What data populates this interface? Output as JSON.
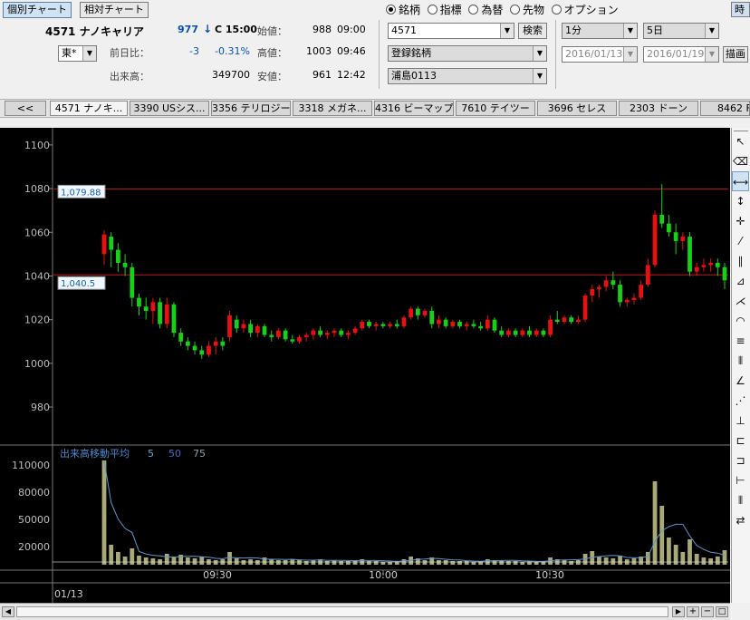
{
  "header": {
    "tab_individual": "個別チャート",
    "tab_relative": "相対チャート",
    "stock_name": "4571 ナノキャリア",
    "exchange": "東*",
    "price": "977",
    "price_arrow": "↓",
    "price_time": "C 15:00",
    "prev_label": "前日比：",
    "change": "-3",
    "change_pct": "-0.31%",
    "volume_label": "出来高：",
    "volume": "349700",
    "open_label": "始値：",
    "open_val": "988",
    "open_time": "09:00",
    "high_label": "高値：",
    "high_val": "1003",
    "high_time": "09:46",
    "low_label": "安値：",
    "low_val": "961",
    "low_time": "12:42"
  },
  "selector": {
    "radios": [
      "銘柄",
      "指標",
      "為替",
      "先物",
      "オプション"
    ],
    "selected": "銘柄",
    "code_value": "4571",
    "search_label": "検索",
    "registered": "登録銘柄",
    "list_name": "浦島0113",
    "interval": "1分",
    "period": "5日",
    "date_from": "2016/01/13",
    "date_to": "2016/01/19",
    "draw_label": "描画",
    "corner_label": "時"
  },
  "tabs": [
    "<<",
    "4571 ナノキ...",
    "3390 USシス...",
    "3356 テリロジー",
    "3318 メガネ...",
    "4316 ビーマップ",
    "7610 テイツー",
    "3696 セレス",
    "2303 ドーン",
    "8462 F"
  ],
  "chart_data": {
    "type": "candlestick",
    "price_ticks": [
      1100,
      1080,
      1060,
      1040,
      1020,
      1000,
      980
    ],
    "price_range": [
      963,
      1107
    ],
    "lines": [
      {
        "label": "1,079.88",
        "value": 1079.88
      },
      {
        "label": "1,040.5",
        "value": 1040.5
      }
    ],
    "volume_label": "出来高移動平均",
    "ma_periods": [
      "5",
      "50",
      "75"
    ],
    "volume_ticks": [
      110000,
      80000,
      50000,
      20000
    ],
    "volume_range": [
      0,
      125000
    ],
    "time_labels": [
      "09:30",
      "10:00",
      "10:30"
    ],
    "date_label": "01/13",
    "candles": [
      {
        "o": 1050,
        "h": 1061,
        "l": 1045,
        "c": 1059,
        "v": 115000
      },
      {
        "o": 1058,
        "h": 1060,
        "l": 1044,
        "c": 1052,
        "v": 22000
      },
      {
        "o": 1052,
        "h": 1055,
        "l": 1042,
        "c": 1046,
        "v": 14000
      },
      {
        "o": 1046,
        "h": 1050,
        "l": 1040,
        "c": 1044,
        "v": 9000
      },
      {
        "o": 1044,
        "h": 1046,
        "l": 1026,
        "c": 1030,
        "v": 18000
      },
      {
        "o": 1030,
        "h": 1032,
        "l": 1022,
        "c": 1026,
        "v": 10000
      },
      {
        "o": 1026,
        "h": 1030,
        "l": 1020,
        "c": 1024,
        "v": 8000
      },
      {
        "o": 1024,
        "h": 1030,
        "l": 1018,
        "c": 1028,
        "v": 7000
      },
      {
        "o": 1028,
        "h": 1030,
        "l": 1016,
        "c": 1018,
        "v": 6000
      },
      {
        "o": 1018,
        "h": 1030,
        "l": 1016,
        "c": 1027,
        "v": 12000
      },
      {
        "o": 1027,
        "h": 1028,
        "l": 1012,
        "c": 1014,
        "v": 9000
      },
      {
        "o": 1014,
        "h": 1016,
        "l": 1008,
        "c": 1010,
        "v": 11000
      },
      {
        "o": 1010,
        "h": 1012,
        "l": 1006,
        "c": 1008,
        "v": 8000
      },
      {
        "o": 1008,
        "h": 1010,
        "l": 1004,
        "c": 1006,
        "v": 7000
      },
      {
        "o": 1006,
        "h": 1008,
        "l": 1002,
        "c": 1004,
        "v": 9000
      },
      {
        "o": 1004,
        "h": 1010,
        "l": 1003,
        "c": 1008,
        "v": 6000
      },
      {
        "o": 1008,
        "h": 1012,
        "l": 1004,
        "c": 1010,
        "v": 5000
      },
      {
        "o": 1010,
        "h": 1012,
        "l": 1006,
        "c": 1008,
        "v": 6000
      },
      {
        "o": 1012,
        "h": 1024,
        "l": 1010,
        "c": 1022,
        "v": 14000
      },
      {
        "o": 1020,
        "h": 1022,
        "l": 1014,
        "c": 1016,
        "v": 7000
      },
      {
        "o": 1016,
        "h": 1020,
        "l": 1014,
        "c": 1018,
        "v": 5000
      },
      {
        "o": 1018,
        "h": 1020,
        "l": 1012,
        "c": 1014,
        "v": 6000
      },
      {
        "o": 1014,
        "h": 1018,
        "l": 1012,
        "c": 1017,
        "v": 5000
      },
      {
        "o": 1017,
        "h": 1018,
        "l": 1012,
        "c": 1013,
        "v": 8000
      },
      {
        "o": 1013,
        "h": 1015,
        "l": 1010,
        "c": 1012,
        "v": 6000
      },
      {
        "o": 1012,
        "h": 1016,
        "l": 1011,
        "c": 1015,
        "v": 5000
      },
      {
        "o": 1015,
        "h": 1016,
        "l": 1010,
        "c": 1011,
        "v": 5000
      },
      {
        "o": 1011,
        "h": 1013,
        "l": 1009,
        "c": 1010,
        "v": 6000
      },
      {
        "o": 1010,
        "h": 1013,
        "l": 1009,
        "c": 1012,
        "v": 5000
      },
      {
        "o": 1012,
        "h": 1014,
        "l": 1010,
        "c": 1013,
        "v": 4000
      },
      {
        "o": 1013,
        "h": 1016,
        "l": 1011,
        "c": 1015,
        "v": 5000
      },
      {
        "o": 1015,
        "h": 1017,
        "l": 1012,
        "c": 1013,
        "v": 6000
      },
      {
        "o": 1013,
        "h": 1015,
        "l": 1011,
        "c": 1014,
        "v": 4000
      },
      {
        "o": 1014,
        "h": 1016,
        "l": 1012,
        "c": 1015,
        "v": 5000
      },
      {
        "o": 1015,
        "h": 1016,
        "l": 1012,
        "c": 1013,
        "v": 4000
      },
      {
        "o": 1013,
        "h": 1015,
        "l": 1011,
        "c": 1014,
        "v": 4000
      },
      {
        "o": 1014,
        "h": 1017,
        "l": 1013,
        "c": 1016,
        "v": 5000
      },
      {
        "o": 1016,
        "h": 1020,
        "l": 1015,
        "c": 1019,
        "v": 6000
      },
      {
        "o": 1019,
        "h": 1020,
        "l": 1016,
        "c": 1017,
        "v": 4000
      },
      {
        "o": 1017,
        "h": 1019,
        "l": 1015,
        "c": 1018,
        "v": 4000
      },
      {
        "o": 1018,
        "h": 1019,
        "l": 1016,
        "c": 1017,
        "v": 3000
      },
      {
        "o": 1017,
        "h": 1019,
        "l": 1016,
        "c": 1018,
        "v": 3000
      },
      {
        "o": 1018,
        "h": 1020,
        "l": 1016,
        "c": 1017,
        "v": 4000
      },
      {
        "o": 1017,
        "h": 1022,
        "l": 1016,
        "c": 1021,
        "v": 6000
      },
      {
        "o": 1021,
        "h": 1026,
        "l": 1020,
        "c": 1025,
        "v": 9000
      },
      {
        "o": 1025,
        "h": 1026,
        "l": 1020,
        "c": 1022,
        "v": 7000
      },
      {
        "o": 1022,
        "h": 1025,
        "l": 1021,
        "c": 1024,
        "v": 5000
      },
      {
        "o": 1024,
        "h": 1026,
        "l": 1016,
        "c": 1018,
        "v": 8000
      },
      {
        "o": 1018,
        "h": 1022,
        "l": 1016,
        "c": 1020,
        "v": 5000
      },
      {
        "o": 1020,
        "h": 1021,
        "l": 1016,
        "c": 1017,
        "v": 5000
      },
      {
        "o": 1017,
        "h": 1020,
        "l": 1016,
        "c": 1019,
        "v": 4000
      },
      {
        "o": 1019,
        "h": 1020,
        "l": 1016,
        "c": 1017,
        "v": 4000
      },
      {
        "o": 1017,
        "h": 1019,
        "l": 1015,
        "c": 1018,
        "v": 4000
      },
      {
        "o": 1018,
        "h": 1020,
        "l": 1016,
        "c": 1017,
        "v": 3000
      },
      {
        "o": 1017,
        "h": 1019,
        "l": 1015,
        "c": 1016,
        "v": 4000
      },
      {
        "o": 1016,
        "h": 1022,
        "l": 1015,
        "c": 1020,
        "v": 6000
      },
      {
        "o": 1020,
        "h": 1021,
        "l": 1014,
        "c": 1015,
        "v": 5000
      },
      {
        "o": 1015,
        "h": 1017,
        "l": 1012,
        "c": 1013,
        "v": 5000
      },
      {
        "o": 1013,
        "h": 1016,
        "l": 1012,
        "c": 1015,
        "v": 4000
      },
      {
        "o": 1015,
        "h": 1016,
        "l": 1012,
        "c": 1013,
        "v": 4000
      },
      {
        "o": 1013,
        "h": 1016,
        "l": 1012,
        "c": 1015,
        "v": 3000
      },
      {
        "o": 1015,
        "h": 1017,
        "l": 1012,
        "c": 1013,
        "v": 4000
      },
      {
        "o": 1013,
        "h": 1016,
        "l": 1012,
        "c": 1015,
        "v": 3000
      },
      {
        "o": 1015,
        "h": 1016,
        "l": 1012,
        "c": 1013,
        "v": 4000
      },
      {
        "o": 1013,
        "h": 1022,
        "l": 1012,
        "c": 1020,
        "v": 8000
      },
      {
        "o": 1020,
        "h": 1024,
        "l": 1018,
        "c": 1019,
        "v": 6000
      },
      {
        "o": 1019,
        "h": 1022,
        "l": 1018,
        "c": 1021,
        "v": 5000
      },
      {
        "o": 1021,
        "h": 1022,
        "l": 1018,
        "c": 1019,
        "v": 4000
      },
      {
        "o": 1019,
        "h": 1022,
        "l": 1018,
        "c": 1020,
        "v": 5000
      },
      {
        "o": 1020,
        "h": 1032,
        "l": 1019,
        "c": 1031,
        "v": 12000
      },
      {
        "o": 1031,
        "h": 1036,
        "l": 1028,
        "c": 1034,
        "v": 15000
      },
      {
        "o": 1034,
        "h": 1036,
        "l": 1030,
        "c": 1035,
        "v": 9000
      },
      {
        "o": 1035,
        "h": 1040,
        "l": 1033,
        "c": 1038,
        "v": 8000
      },
      {
        "o": 1038,
        "h": 1042,
        "l": 1034,
        "c": 1036,
        "v": 7000
      },
      {
        "o": 1036,
        "h": 1038,
        "l": 1026,
        "c": 1028,
        "v": 10000
      },
      {
        "o": 1028,
        "h": 1030,
        "l": 1026,
        "c": 1029,
        "v": 6000
      },
      {
        "o": 1029,
        "h": 1032,
        "l": 1027,
        "c": 1030,
        "v": 7000
      },
      {
        "o": 1030,
        "h": 1038,
        "l": 1029,
        "c": 1036,
        "v": 9000
      },
      {
        "o": 1036,
        "h": 1048,
        "l": 1035,
        "c": 1045,
        "v": 14000
      },
      {
        "o": 1045,
        "h": 1070,
        "l": 1044,
        "c": 1068,
        "v": 92000
      },
      {
        "o": 1068,
        "h": 1082,
        "l": 1062,
        "c": 1064,
        "v": 65000
      },
      {
        "o": 1064,
        "h": 1068,
        "l": 1058,
        "c": 1060,
        "v": 30000
      },
      {
        "o": 1060,
        "h": 1064,
        "l": 1050,
        "c": 1056,
        "v": 22000
      },
      {
        "o": 1056,
        "h": 1060,
        "l": 1052,
        "c": 1058,
        "v": 14000
      },
      {
        "o": 1058,
        "h": 1060,
        "l": 1040,
        "c": 1042,
        "v": 28000
      },
      {
        "o": 1042,
        "h": 1046,
        "l": 1040,
        "c": 1044,
        "v": 12000
      },
      {
        "o": 1044,
        "h": 1048,
        "l": 1042,
        "c": 1045,
        "v": 8000
      },
      {
        "o": 1045,
        "h": 1048,
        "l": 1042,
        "c": 1046,
        "v": 7000
      },
      {
        "o": 1046,
        "h": 1048,
        "l": 1040,
        "c": 1044,
        "v": 9000
      },
      {
        "o": 1044,
        "h": 1046,
        "l": 1034,
        "c": 1038,
        "v": 16000
      }
    ]
  },
  "colors": {
    "up": "#e81010",
    "down": "#18d018",
    "volume": "#a8a878",
    "hline": "#c01818",
    "ma_blue": "#5a98d0",
    "ma_white": "#e8e8e8",
    "grid": "#3a3a3a",
    "label_blue": "#4a8ad0"
  }
}
